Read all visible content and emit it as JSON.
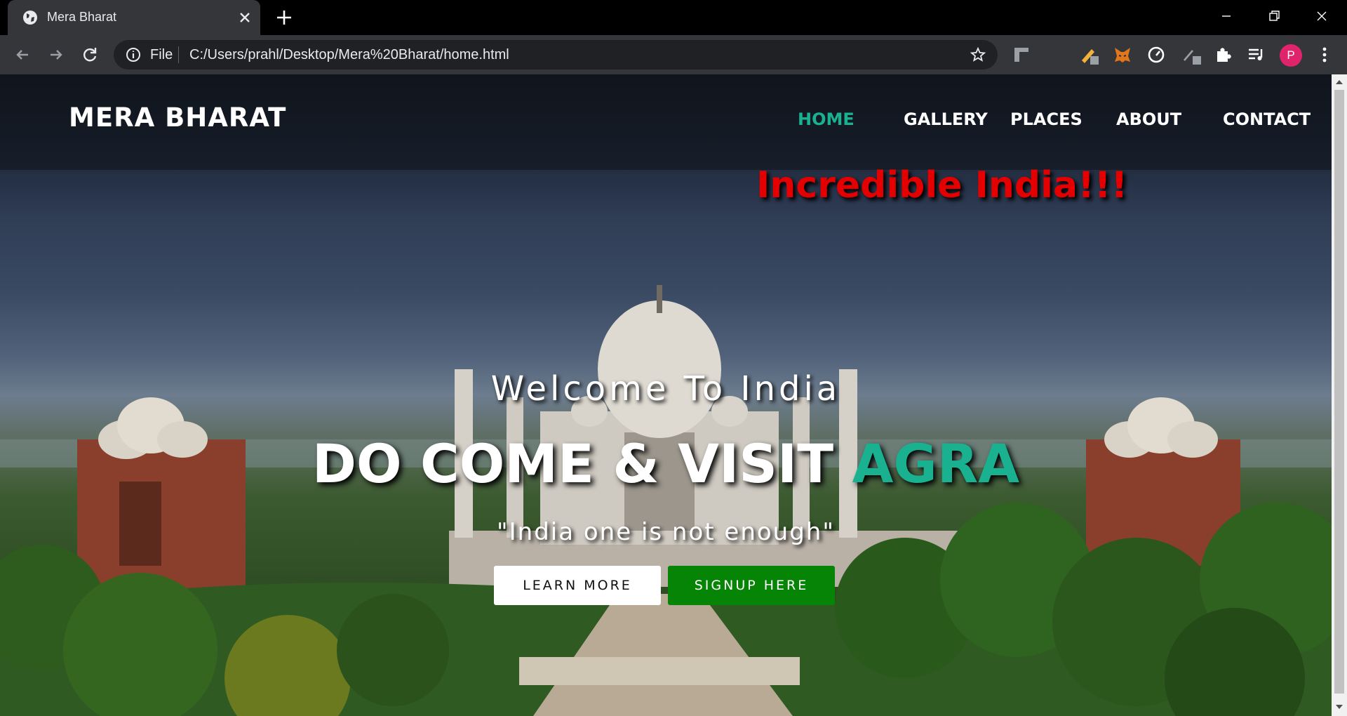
{
  "browser": {
    "tab_title": "Mera Bharat",
    "url_scheme": "File",
    "url": "C:/Users/prahl/Desktop/Mera%20Bharat/home.html",
    "profile_initial": "P"
  },
  "site": {
    "logo": "MERA BHARAT",
    "nav": [
      "HOME",
      "GALLERY",
      "PLACES",
      "ABOUT",
      "CONTACT"
    ],
    "active_nav": "HOME",
    "tagline": "Incredible India!!!",
    "welcome": "Welcome To India",
    "headline_main": "DO COME & VISIT ",
    "headline_accent": "AGRA",
    "quote": "\"India one is not enough\"",
    "learn_more": "LEARN MORE",
    "signup": "SIGNUP HERE"
  },
  "colors": {
    "accent": "#19b190",
    "tagline": "#e40000",
    "signup_button": "#068406"
  }
}
